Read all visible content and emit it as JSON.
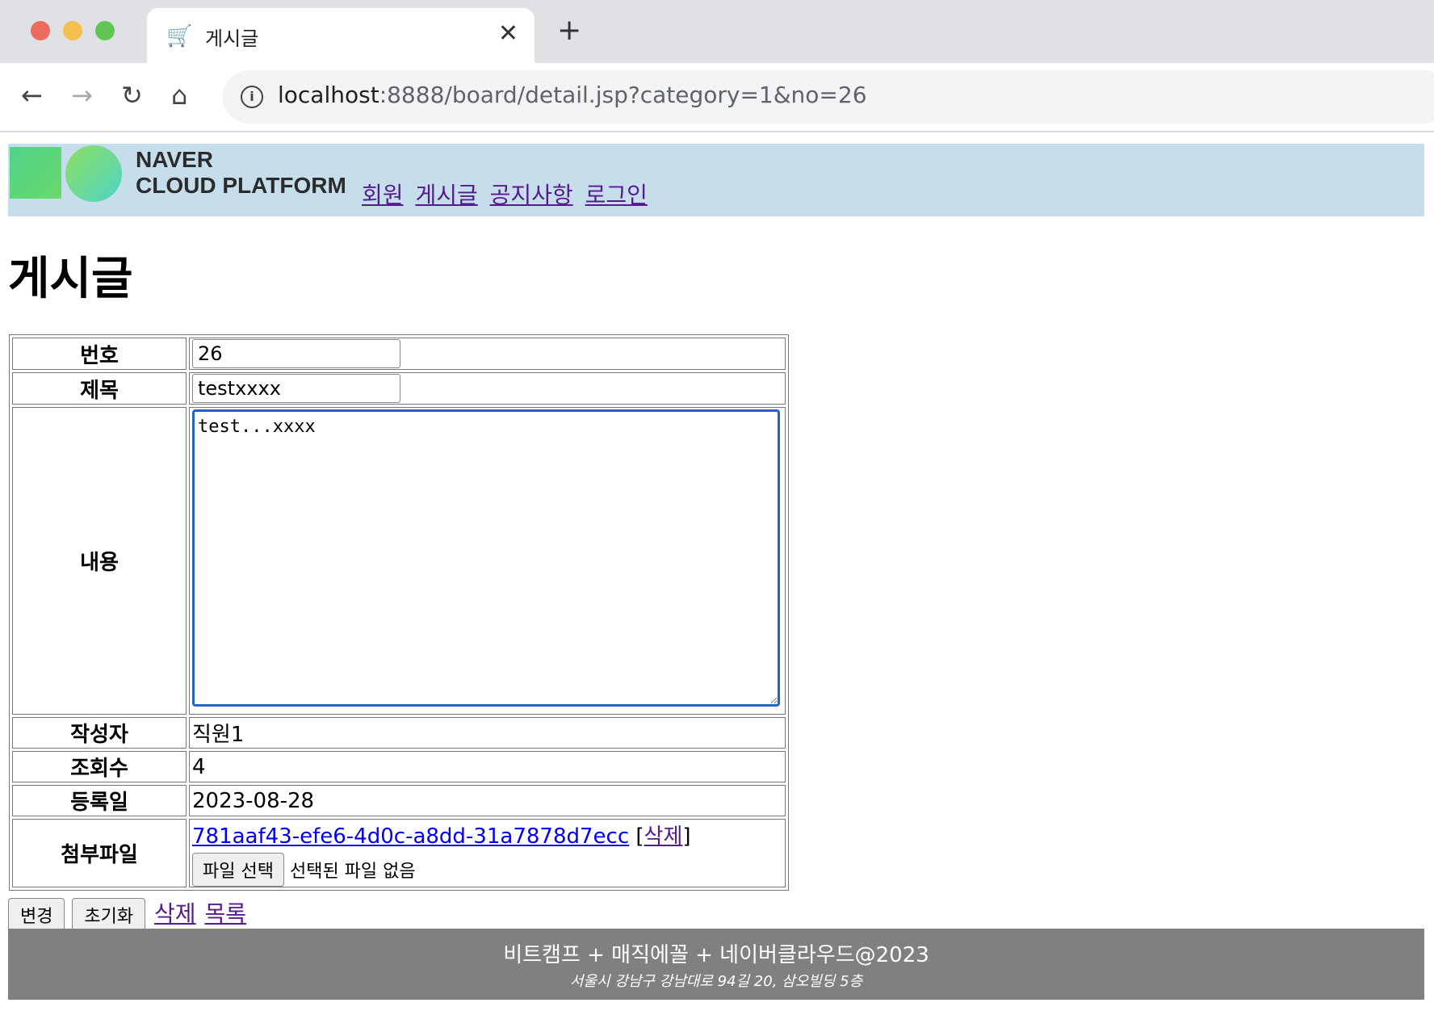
{
  "browser": {
    "tab_title": "게시글",
    "url_host": "localhost",
    "url_rest": ":8888/board/detail.jsp?category=1&no=26"
  },
  "header": {
    "logo_line1": "NAVER",
    "logo_line2": "CLOUD PLATFORM",
    "menu": [
      "회원",
      "게시글",
      "공지사항",
      "로그인"
    ]
  },
  "page": {
    "title": "게시글"
  },
  "form": {
    "labels": {
      "no": "번호",
      "title": "제목",
      "content": "내용",
      "writer": "작성자",
      "views": "조회수",
      "created": "등록일",
      "attachment": "첨부파일"
    },
    "no_value": "26",
    "title_value": "testxxxx",
    "content_value": "test...xxxx",
    "writer_value": "직원1",
    "views_value": "4",
    "created_value": "2023-08-28",
    "attachment_link": "781aaf43-efe6-4d0c-a8dd-31a7878d7ecc",
    "attachment_delete": "삭제",
    "file_button": "파일 선택",
    "file_status": "선택된 파일 없음"
  },
  "actions": {
    "update": "변경",
    "reset": "초기화",
    "delete": "삭제",
    "list": "목록"
  },
  "footer": {
    "line1": "비트캠프 + 매직에꼴 + 네이버클라우드@2023",
    "line2": "서울시 강남구 강남대로 94길 20, 삼오빌딩 5층"
  }
}
